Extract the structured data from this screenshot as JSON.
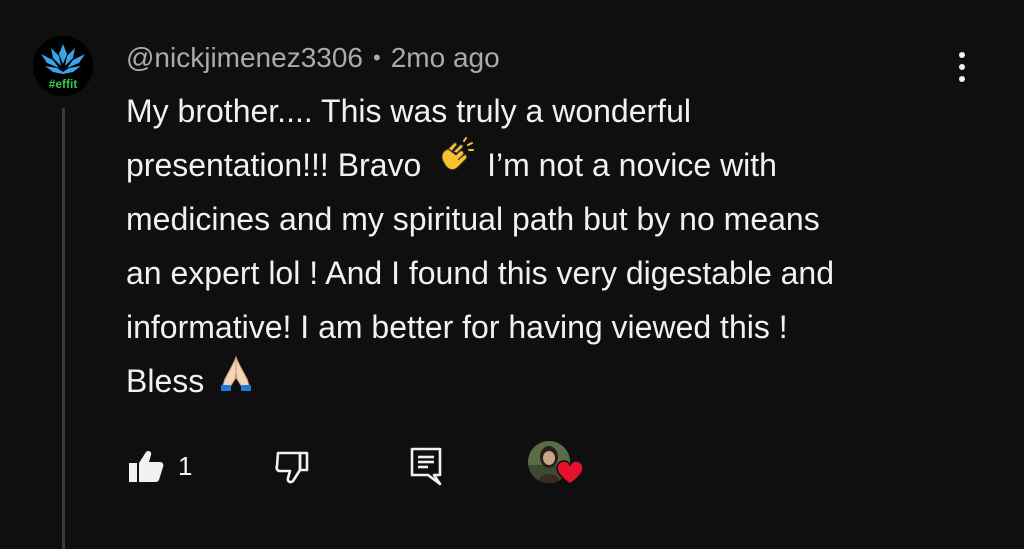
{
  "comment": {
    "author": "@nickjimenez3306",
    "separator": "•",
    "time": "2mo ago",
    "avatar": {
      "label": "#effit",
      "icon": "lotus-logo-icon",
      "colors": {
        "lotus": "#3aa3e8",
        "text": "#36c94a",
        "background": "#000000"
      }
    },
    "text_lines": [
      "My brother.... This was truly a wonderful",
      [
        "presentation!!! Bravo ",
        "clapping-hands-emoji",
        " I’m not a novice with"
      ],
      "medicines and my spiritual path but by no means",
      "an expert lol ! And I found this very digestable and",
      "informative! I am better for having viewed this !",
      [
        "Bless ",
        "folded-hands-emoji",
        ""
      ]
    ],
    "text": {
      "line1": "My brother.... This was truly a wonderful",
      "line2a": "presentation!!! Bravo ",
      "line2b": " I’m not a novice with",
      "line3": "medicines and my spiritual path but by no means",
      "line4": "an expert lol ! And I found this very digestable and",
      "line5": "informative! I am better for having viewed this !",
      "line6": "Bless "
    },
    "emojis": [
      "clapping-hands-emoji",
      "folded-hands-emoji"
    ]
  },
  "actions": {
    "like_icon": "thumbs-up-filled-icon",
    "like_count": "1",
    "dislike_icon": "thumbs-down-outline-icon",
    "reply_icon": "reply-comment-icon",
    "creator_heart_icon": "creator-heart-icon",
    "heart_color": "#e8112d"
  },
  "menu_icon": "more-vertical-icon",
  "theme": {
    "background": "#0f0f0f",
    "text_primary": "#f1f1f1",
    "text_secondary": "#aaaaaa"
  }
}
